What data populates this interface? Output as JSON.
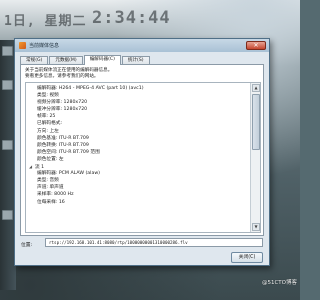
{
  "background": {
    "date_text": "1日, 星期二",
    "clock_text": "2:34:44"
  },
  "window": {
    "title": "当前媒体信息",
    "close_glyph": "✕"
  },
  "tabs": [
    {
      "label": "常规(G)"
    },
    {
      "label": "元数据(M)"
    },
    {
      "label": "编解码器(C)"
    },
    {
      "label": "统计(S)"
    }
  ],
  "panel": {
    "hint_line1": "关于当前媒体流正在使用的编解码器信息。",
    "hint_line2": "要看更多信息，请参考我们的网站。"
  },
  "tree": {
    "rows": [
      {
        "text": "编解码器: H264 - MPEG-4 AVC (part 10) (avc1)",
        "level": 1
      },
      {
        "text": "类型: 视频",
        "level": 1
      },
      {
        "text": "视频分辨率: 1280x720",
        "level": 1
      },
      {
        "text": "缓冲分辨率: 1280x720",
        "level": 1
      },
      {
        "text": "帧率: 25",
        "level": 1
      },
      {
        "text": "已解码格式:",
        "level": 1
      },
      {
        "text": "方向: 上左",
        "level": 1
      },
      {
        "text": "颜色基准: ITU-R BT.709",
        "level": 1
      },
      {
        "text": "颜色转换: ITU-R BT.709",
        "level": 1
      },
      {
        "text": "颜色空间: ITU-R BT.709 范围",
        "level": 1
      },
      {
        "text": "颜色位置: 左",
        "level": 1
      },
      {
        "text": "流 1",
        "level": 0,
        "expander": "◢"
      },
      {
        "text": "编解码器: PCM ALAW (alaw)",
        "level": 1
      },
      {
        "text": "类型: 音频",
        "level": 1
      },
      {
        "text": "声道: 单声道",
        "level": 1
      },
      {
        "text": "采样率: 8000 Hz",
        "level": 1
      },
      {
        "text": "位每采样: 16",
        "level": 1
      }
    ],
    "scroll_up_glyph": "▲",
    "scroll_down_glyph": "▼"
  },
  "location": {
    "label": "位置:",
    "value": "rtsp://192.168.101.41:8080/rtp/10000000001310000286.flv"
  },
  "buttons": {
    "close_label": "关闭(C)"
  },
  "watermark": "@51CTO博客"
}
